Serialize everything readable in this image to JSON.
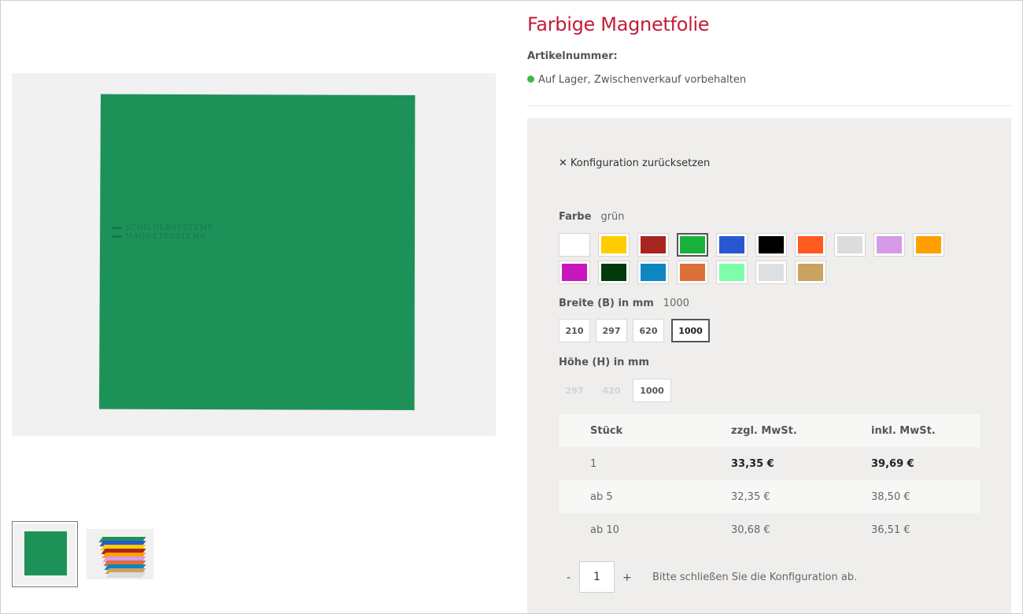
{
  "product": {
    "title": "Farbige Magnetfolie",
    "article_label": "Artikelnummer:",
    "stock_text": "Auf Lager, Zwischenverkauf vorbehalten",
    "stock_color": "#3cb84a"
  },
  "config": {
    "reset_icon": "✕",
    "reset_label": "Konfiguration zurücksetzen",
    "color": {
      "label": "Farbe",
      "value": "grün",
      "swatches": [
        {
          "name": "white",
          "hex": "#ffffff",
          "selected": false
        },
        {
          "name": "yellow",
          "hex": "#ffcc00",
          "selected": false
        },
        {
          "name": "red",
          "hex": "#a9251f",
          "selected": false
        },
        {
          "name": "green",
          "hex": "#18b13b",
          "selected": true
        },
        {
          "name": "blue",
          "hex": "#2857d1",
          "selected": false
        },
        {
          "name": "black",
          "hex": "#000000",
          "selected": false
        },
        {
          "name": "orange-red",
          "hex": "#ff5a1f",
          "selected": false
        },
        {
          "name": "light-grey",
          "hex": "#dcdcde",
          "selected": false
        },
        {
          "name": "lilac",
          "hex": "#d59be6",
          "selected": false
        },
        {
          "name": "orange",
          "hex": "#ffa000",
          "selected": false
        },
        {
          "name": "magenta",
          "hex": "#c818bd",
          "selected": false
        },
        {
          "name": "dark-green",
          "hex": "#023b0b",
          "selected": false
        },
        {
          "name": "cyan-blue",
          "hex": "#0d86c2",
          "selected": false
        },
        {
          "name": "copper",
          "hex": "#dd7038",
          "selected": false
        },
        {
          "name": "mint",
          "hex": "#7dffaa",
          "selected": false
        },
        {
          "name": "silver",
          "hex": "#dde0e2",
          "selected": false
        },
        {
          "name": "gold",
          "hex": "#c9a35f",
          "selected": false
        }
      ]
    },
    "width": {
      "label": "Breite (B) in mm",
      "value": "1000",
      "options": [
        {
          "label": "210",
          "state": "normal"
        },
        {
          "label": "297",
          "state": "normal"
        },
        {
          "label": "620",
          "state": "normal"
        },
        {
          "label": "1000",
          "state": "selected"
        }
      ]
    },
    "height": {
      "label": "Höhe (H) in mm",
      "options": [
        {
          "label": "297",
          "state": "disabled"
        },
        {
          "label": "420",
          "state": "disabled"
        },
        {
          "label": "1000",
          "state": "normal"
        }
      ]
    }
  },
  "prices": {
    "headers": [
      "Stück",
      "zzgl. MwSt.",
      "inkl. MwSt."
    ],
    "rows": [
      [
        "1",
        "33,35 €",
        "39,69 €"
      ],
      [
        "ab 5",
        "32,35 €",
        "38,50 €"
      ],
      [
        "ab 10",
        "30,68 €",
        "36,51 €"
      ]
    ]
  },
  "quantity": {
    "minus": "-",
    "plus": "+",
    "value": "1",
    "hint": "Bitte schließen Sie die Konfiguration ab."
  },
  "image": {
    "watermark_line1": "SCHILDERSYSTEME",
    "watermark_line2": "MAGNETSYSTEME"
  }
}
